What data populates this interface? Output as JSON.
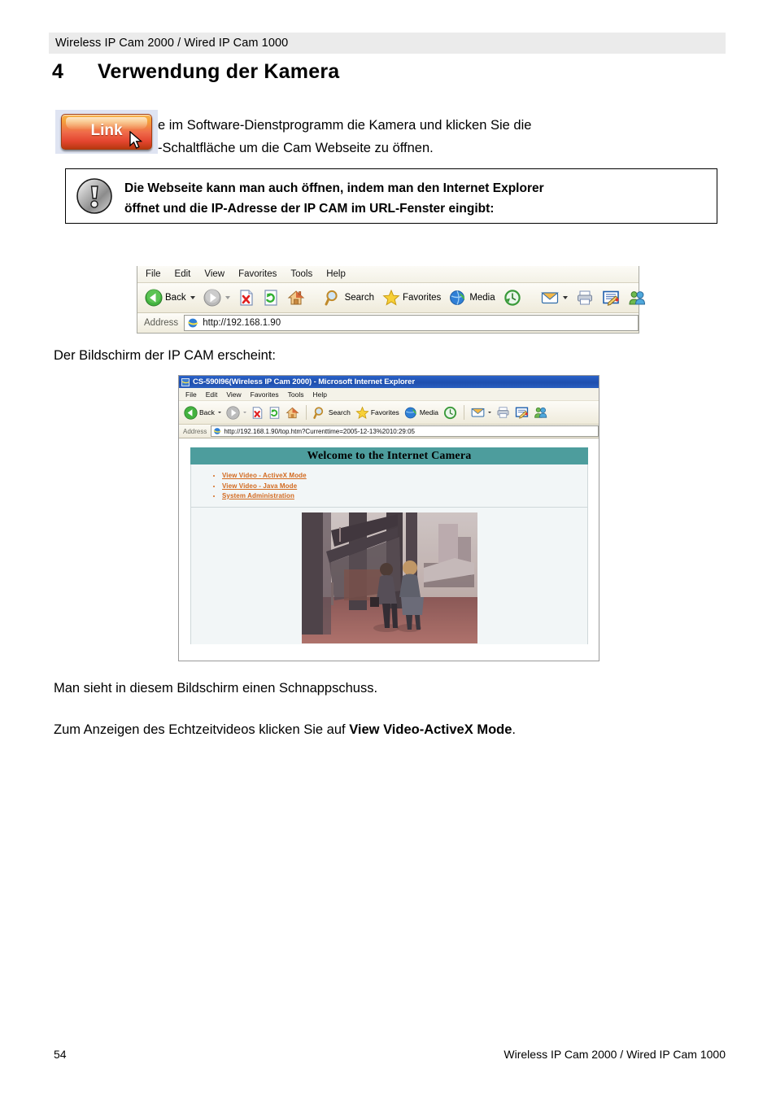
{
  "header": {
    "running_head": "Wireless IP Cam 2000 / Wired IP Cam 1000"
  },
  "chapter": {
    "number": "4",
    "title": "Verwendung der Kamera"
  },
  "intro": {
    "line1": "e im Software-Dienstprogramm die Kamera und klicken Sie die",
    "line2": "-Schaltfläche um die Cam Webseite zu öffnen.",
    "link_button_label": "Link"
  },
  "note": {
    "line1": "Die Webseite kann man auch öffnen, indem man den Internet Explorer",
    "line2": "öffnet und die IP-Adresse der IP CAM im URL-Fenster eingibt:"
  },
  "figure_toolbar": {
    "menu": [
      "File",
      "Edit",
      "View",
      "Favorites",
      "Tools",
      "Help"
    ],
    "buttons": [
      {
        "label": "Back",
        "icon": "back-arrow-icon"
      },
      {
        "label": "",
        "icon": "forward-arrow-icon"
      },
      {
        "label": "",
        "icon": "stop-icon"
      },
      {
        "label": "",
        "icon": "refresh-icon"
      },
      {
        "label": "",
        "icon": "home-icon"
      },
      {
        "label": "Search",
        "icon": "search-icon"
      },
      {
        "label": "Favorites",
        "icon": "star-icon"
      },
      {
        "label": "Media",
        "icon": "media-icon"
      },
      {
        "label": "",
        "icon": "history-icon"
      },
      {
        "label": "",
        "icon": "mail-icon"
      },
      {
        "label": "",
        "icon": "print-icon"
      },
      {
        "label": "",
        "icon": "edit-icon"
      },
      {
        "label": "",
        "icon": "messenger-icon"
      }
    ],
    "address_label": "Address",
    "address_value": "http://192.168.1.90"
  },
  "caption": {
    "erscheint": "Der Bildschirm der IP CAM erscheint:",
    "schnappschuss": "Man sieht in diesem Bildschirm einen Schnappschuss.",
    "echtzeit_prefix": "Zum Anzeigen des Echtzeitvideos klicken Sie auf ",
    "echtzeit_bold": "View Video-ActiveX Mode",
    "echtzeit_suffix": "."
  },
  "figure_window": {
    "title": "CS-590I96(Wireless IP Cam 2000) - Microsoft Internet Explorer",
    "menu": [
      "File",
      "Edit",
      "View",
      "Favorites",
      "Tools",
      "Help"
    ],
    "buttons": [
      {
        "label": "Back",
        "icon": "back-arrow-icon"
      },
      {
        "label": "",
        "icon": "forward-arrow-icon"
      },
      {
        "label": "",
        "icon": "stop-icon"
      },
      {
        "label": "",
        "icon": "refresh-icon"
      },
      {
        "label": "",
        "icon": "home-icon"
      },
      {
        "label": "Search",
        "icon": "search-icon"
      },
      {
        "label": "Favorites",
        "icon": "star-icon"
      },
      {
        "label": "Media",
        "icon": "media-icon"
      },
      {
        "label": "",
        "icon": "history-icon"
      },
      {
        "label": "",
        "icon": "mail-icon"
      },
      {
        "label": "",
        "icon": "print-icon"
      },
      {
        "label": "",
        "icon": "edit-icon"
      },
      {
        "label": "",
        "icon": "messenger-icon"
      }
    ],
    "address_label": "Address",
    "address_value": "http://192.168.1.90/top.htm?Currenttime=2005-12-13%2010:29:05",
    "page": {
      "banner": "Welcome to the Internet Camera",
      "links": [
        "View Video - ActiveX Mode",
        "View Video - Java Mode",
        "System Administration"
      ]
    }
  },
  "footer": {
    "page_number": "54",
    "running_foot": "Wireless IP Cam 2000 / Wired IP Cam 1000"
  },
  "colors": {
    "header_band": "#ebebeb",
    "banner_teal": "#4d9d9d",
    "link_orange": "#d2691e",
    "titlebar_blue": "#1f4fae"
  }
}
